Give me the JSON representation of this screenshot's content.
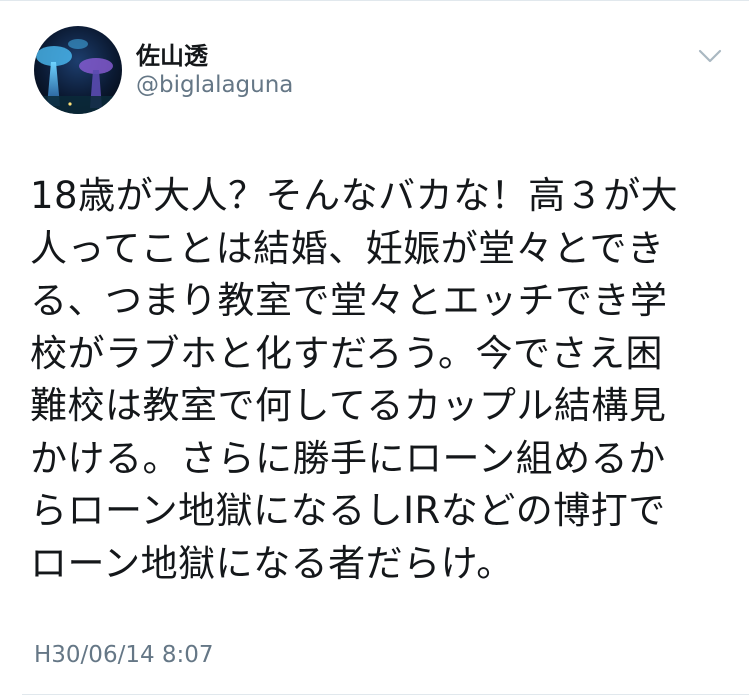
{
  "author": {
    "display_name": "佐山透",
    "handle": "@biglalaguna",
    "avatar_icon": "avatar-photo-icon"
  },
  "menu_icon": "chevron-down-icon",
  "tweet": {
    "lines": [
      "18歳が大人？そんなバカな！高３が大",
      "人ってことは結婚、妊娠が堂々とでき",
      "る、つまり教室で堂々とエッチでき学",
      "校がラブホと化すだろう。今でさえ困",
      "難校は教室で何してるカップル結構見",
      "かける。さらに勝手にローン組めるか",
      "らローン地獄になるしIRなどの博打で",
      "ローン地獄になる者だらけ。"
    ],
    "timestamp": "H30/06/14 8:07"
  },
  "colors": {
    "text": "#14171a",
    "secondary": "#657786",
    "divider": "#e1e8ed"
  }
}
